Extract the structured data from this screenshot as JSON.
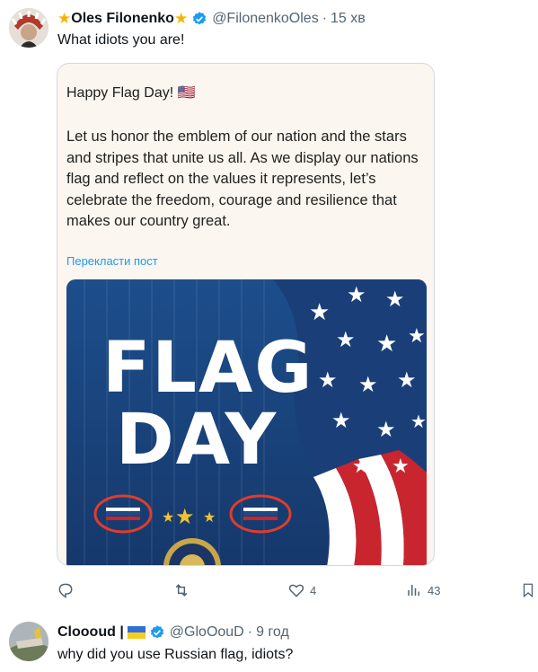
{
  "post": {
    "author": {
      "star_left": "★",
      "display_name": "Oles Filonenko",
      "star_right": "★",
      "handle": "@FilonenkoOles",
      "separator": "·",
      "time": "15 хв"
    },
    "text": "What idiots you are!",
    "quoted": {
      "heading": "Happy Flag Day! 🇺🇸",
      "body": "Let us honor the emblem of our nation and the stars and stripes that unite us all. As we display our nations flag and reflect on the values it represents, let’s celebrate the freedom, courage and resilience that makes our country great.",
      "translate_link": "Перекласти пост",
      "image": {
        "title_line1": "FLAG",
        "title_line2": "DAY",
        "colors": {
          "blue": "#1e4a86",
          "red": "#c8252f",
          "white": "#ffffff",
          "gold": "#f2c230",
          "annotation": "#e23b2a"
        }
      }
    },
    "actions": {
      "replies": "",
      "reposts": "",
      "likes": "4",
      "views": "43"
    }
  },
  "reply": {
    "author": {
      "display_name": "Cloooud |",
      "handle": "@GloOouD",
      "separator": "·",
      "time": "9 год"
    },
    "text": "why did you use Russian flag, idiots?"
  },
  "colors": {
    "verified": "#1d9bf0",
    "muted": "#536471",
    "link": "#1d9bf0"
  }
}
